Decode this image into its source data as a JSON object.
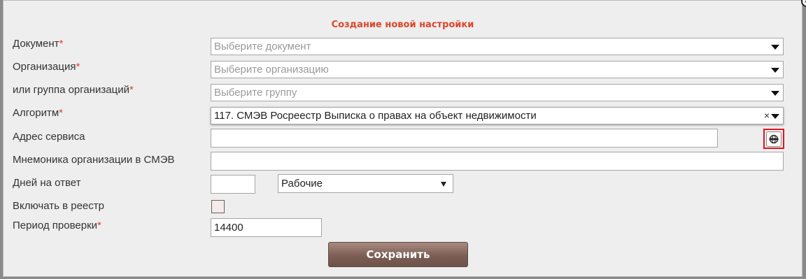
{
  "dialog": {
    "title": "Создание новой настройки",
    "close_glyph": "×"
  },
  "required_mark": "*",
  "fields": {
    "document": {
      "label": "Документ",
      "placeholder": "Выберите документ"
    },
    "organization": {
      "label": "Организация",
      "placeholder": "Выберите организацию"
    },
    "org_group": {
      "label": "или группа организаций",
      "placeholder": "Выберите группу"
    },
    "algorithm": {
      "label": "Алгоритм",
      "value": "117. СМЭВ Росреестр Выписка о правах на объект недвижимости",
      "clear_glyph": "×"
    },
    "service_address": {
      "label": "Адрес сервиса",
      "value": ""
    },
    "smev_mnemonic": {
      "label": "Мнемоника организации в СМЭВ",
      "value": ""
    },
    "response_days": {
      "label": "Дней на ответ",
      "value": "",
      "day_type": "Рабочие"
    },
    "include_in_registry": {
      "label": "Включать в реестр",
      "checked": false
    },
    "check_period": {
      "label": "Период проверки",
      "value": "14400"
    }
  },
  "buttons": {
    "save": "Сохранить"
  },
  "colors": {
    "accent": "#d9472b",
    "highlight_border": "#e0141e",
    "button": "#7c5e55"
  },
  "icons": {
    "service_button": "www-globe-icon",
    "dropdown": "caret-down-icon",
    "close": "close-icon"
  }
}
